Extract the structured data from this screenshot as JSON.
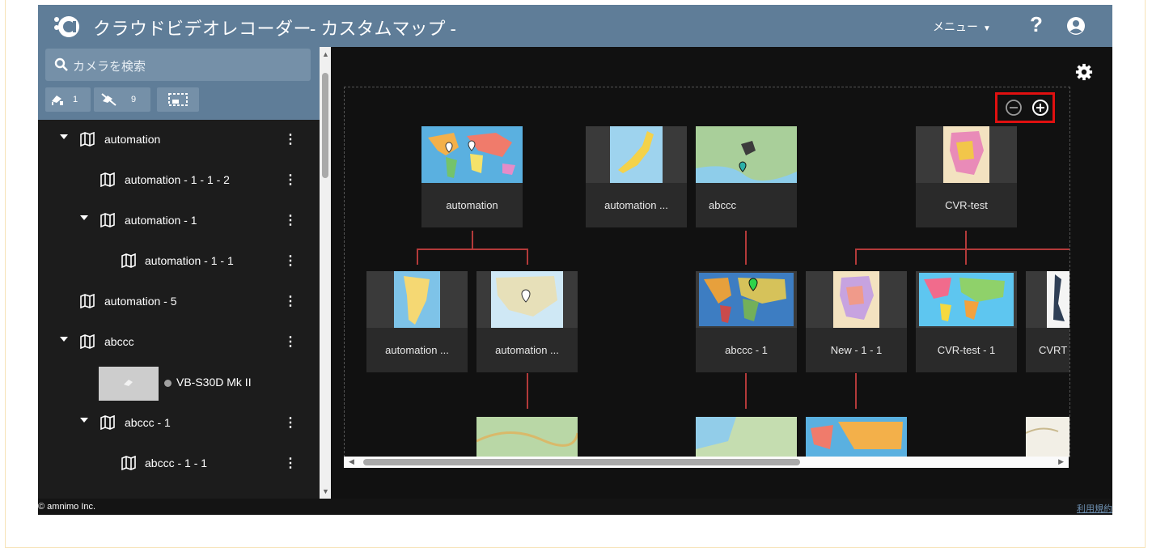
{
  "header": {
    "app_title": "クラウドビデオレコーダー",
    "page_title": "- カスタムマップ -",
    "menu_label": "メニュー",
    "help_label": "?"
  },
  "sidebar": {
    "search_placeholder": "カメラを検索",
    "filters": {
      "online_count": "1",
      "offline_count": "9"
    },
    "tree": [
      {
        "label": "automation",
        "level": 0,
        "expanded": true
      },
      {
        "label": "automation - 1 - 1 - 2",
        "level": 1
      },
      {
        "label": "automation - 1",
        "level": 1,
        "expanded": true
      },
      {
        "label": "automation - 1 - 1",
        "level": 2
      },
      {
        "label": "automation - 5",
        "level": 0
      },
      {
        "label": "abccc",
        "level": 0,
        "expanded": true
      },
      {
        "label": "VB-S30D Mk II",
        "type": "camera"
      },
      {
        "label": "abccc - 1",
        "level": 1,
        "expanded": true
      },
      {
        "label": "abccc - 1 - 1",
        "level": 2
      }
    ]
  },
  "map": {
    "cards": [
      {
        "name": "automation"
      },
      {
        "name": "automation ..."
      },
      {
        "name": "abccc"
      },
      {
        "name": "CVR-test"
      },
      {
        "name": "automation ..."
      },
      {
        "name": "automation ..."
      },
      {
        "name": "abccc - 1"
      },
      {
        "name": "New - 1 - 1"
      },
      {
        "name": "CVR-test - 1"
      },
      {
        "name": "CVRT"
      }
    ]
  },
  "footer": {
    "copyright": "© amnimo Inc.",
    "terms": "利用規約"
  },
  "colors": {
    "header": "#5f7d98",
    "connector": "#b33a3a",
    "highlight": "#e01010"
  }
}
